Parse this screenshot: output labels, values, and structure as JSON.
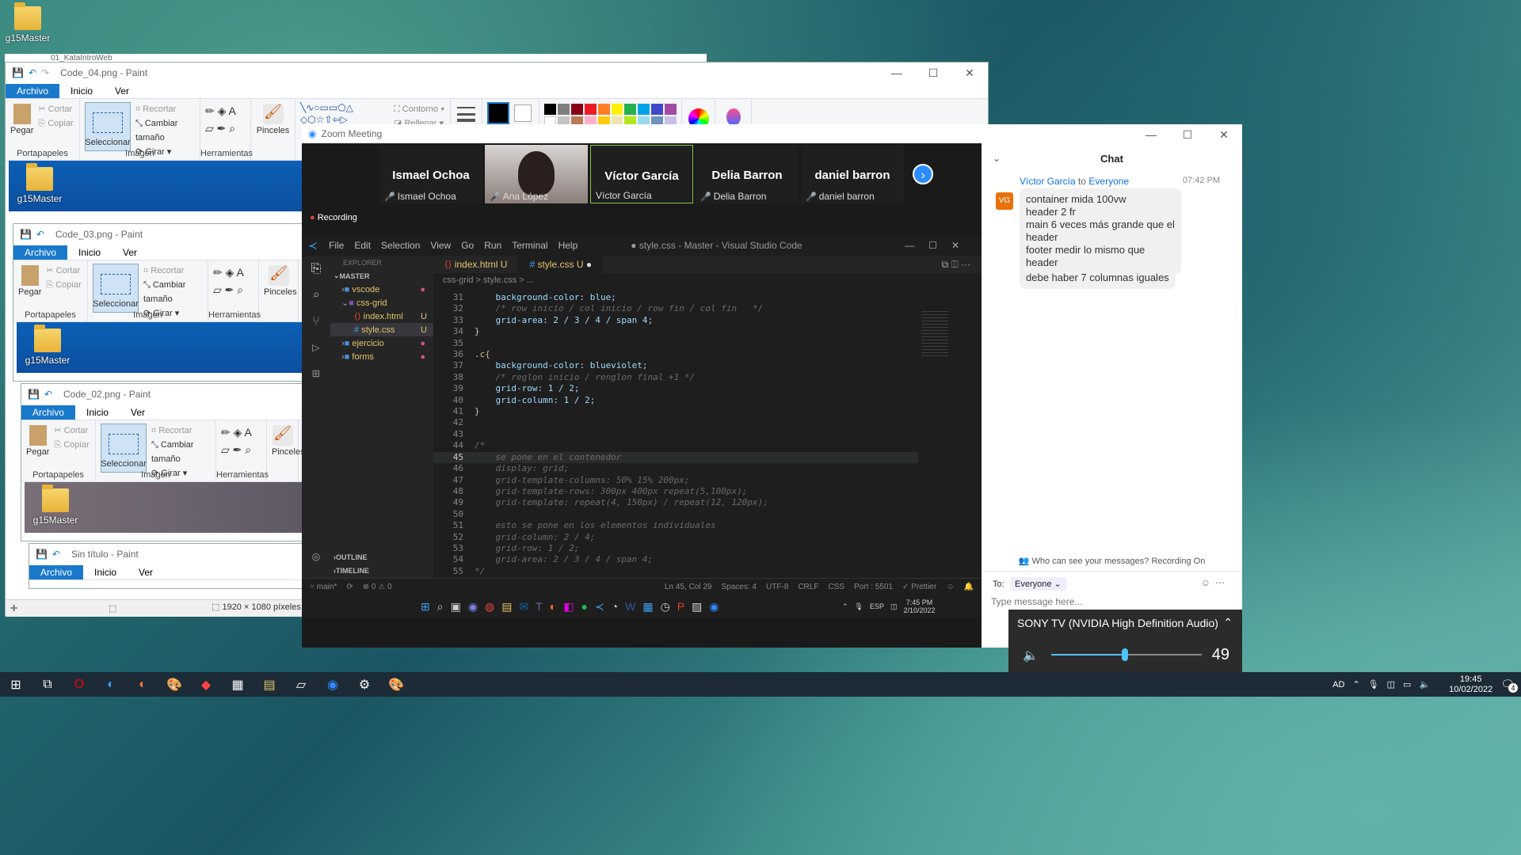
{
  "desktop": {
    "icon_label": "g15Master"
  },
  "bg_paint": {
    "title": "01_KataIntroWeb"
  },
  "paint_windows": [
    {
      "title": "Code_04.png - Paint",
      "folder_label": "g15Master"
    },
    {
      "title": "Code_03.png - Paint",
      "folder_label": "g15Master"
    },
    {
      "title": "Code_02.png - Paint",
      "folder_label": "g15Master"
    },
    {
      "title": "Sin título - Paint"
    }
  ],
  "paint_ribbon": {
    "tab_file": "Archivo",
    "tab_home": "Inicio",
    "tab_view": "Ver",
    "paste": "Pegar",
    "cut": "Cortar",
    "copy": "Copiar",
    "select": "Seleccionar",
    "crop": "Recortar",
    "resize": "Cambiar tamaño",
    "rotate": "Girar",
    "brushes": "Pinceles",
    "outline": "Contorno",
    "fill": "Rellenar",
    "group_clipboard": "Portapapeles",
    "group_image": "Imagen",
    "group_tools": "Herramientas"
  },
  "paint_status": {
    "dimensions": "1920 × 1080 píxeles"
  },
  "zoom": {
    "title": "Zoom Meeting",
    "recording": "Recording",
    "participants": [
      {
        "big": "Ismael Ochoa",
        "label": "Ismael Ochoa"
      },
      {
        "big": "",
        "label": "Ana López"
      },
      {
        "big": "Víctor García",
        "label": "Víctor García"
      },
      {
        "big": "Delia Barron",
        "label": "Delia Barron"
      },
      {
        "big": "daniel barron",
        "label": "daniel barron"
      }
    ]
  },
  "vscode": {
    "menu": [
      "File",
      "Edit",
      "Selection",
      "View",
      "Go",
      "Run",
      "Terminal",
      "Help"
    ],
    "title": "● style.css - Master - Visual Studio Code",
    "explorer": "EXPLORER",
    "master": "MASTER",
    "tree": [
      {
        "name": "vscode",
        "type": "folder",
        "indent": 0
      },
      {
        "name": "css-grid",
        "type": "folder-open",
        "indent": 0
      },
      {
        "name": "index.html",
        "type": "html",
        "indent": 1,
        "badge": "U"
      },
      {
        "name": "style.css",
        "type": "css",
        "indent": 1,
        "badge": "U"
      },
      {
        "name": "ejercicio",
        "type": "folder",
        "indent": 0
      },
      {
        "name": "forms",
        "type": "folder",
        "indent": 0
      }
    ],
    "outline": "OUTLINE",
    "timeline": "TIMELINE",
    "tabs": [
      {
        "label": "index.html",
        "badge": "U"
      },
      {
        "label": "style.css",
        "badge": "U"
      }
    ],
    "breadcrumb": "css-grid  >  style.css  >  ...",
    "code": [
      {
        "n": "31",
        "t": "    background-color: blue;",
        "k": "prop"
      },
      {
        "n": "32",
        "t": "    /* row inicio / col inicio / row fin / col fin   */",
        "k": "cm"
      },
      {
        "n": "33",
        "t": "    grid-area: 2 / 3 / 4 / span 4;",
        "k": "prop"
      },
      {
        "n": "34",
        "t": "}",
        "k": "br"
      },
      {
        "n": "35",
        "t": "",
        "k": ""
      },
      {
        "n": "36",
        "t": ".c{",
        "k": "sel"
      },
      {
        "n": "37",
        "t": "    background-color: blueviolet;",
        "k": "prop"
      },
      {
        "n": "38",
        "t": "    /* reglon inicio / renglon final +1 */",
        "k": "cm"
      },
      {
        "n": "39",
        "t": "    grid-row: 1 / 2;",
        "k": "prop"
      },
      {
        "n": "40",
        "t": "    grid-column: 1 / 2;",
        "k": "prop"
      },
      {
        "n": "41",
        "t": "}",
        "k": "br"
      },
      {
        "n": "42",
        "t": "",
        "k": ""
      },
      {
        "n": "43",
        "t": "",
        "k": ""
      },
      {
        "n": "44",
        "t": "/*",
        "k": "cm"
      },
      {
        "n": "45",
        "t": "    se pone en el contenedor",
        "k": "cm"
      },
      {
        "n": "46",
        "t": "    display: grid;",
        "k": "cm"
      },
      {
        "n": "47",
        "t": "    grid-template-columns: 50% 15% 200px;",
        "k": "cm"
      },
      {
        "n": "48",
        "t": "    grid-template-rows: 300px 400px repeat(5,100px);",
        "k": "cm"
      },
      {
        "n": "49",
        "t": "    grid-template: repeat(4, 150px) / repeat(12, 120px);",
        "k": "cm"
      },
      {
        "n": "50",
        "t": "",
        "k": ""
      },
      {
        "n": "51",
        "t": "    esto se pone en los elementos individuales",
        "k": "cm"
      },
      {
        "n": "52",
        "t": "    grid-column: 2 / 4;",
        "k": "cm"
      },
      {
        "n": "53",
        "t": "    grid-row: 1 / 2;",
        "k": "cm"
      },
      {
        "n": "54",
        "t": "    grid-area: 2 / 3 / 4 / span 4;",
        "k": "cm"
      },
      {
        "n": "55",
        "t": "*/",
        "k": "cm"
      }
    ],
    "status": {
      "branch": "main*",
      "errors": "⊗ 0 ⚠ 0",
      "pos": "Ln 45, Col 29",
      "spaces": "Spaces: 4",
      "enc": "UTF-8",
      "eol": "CRLF",
      "lang": "CSS",
      "port": "Port : 5501",
      "prettier": "✓ Prettier"
    }
  },
  "chat": {
    "title": "Chat",
    "sender": "Víctor García",
    "to": "to",
    "recipient": "Everyone",
    "time": "07:42 PM",
    "avatar": "VG",
    "messages": [
      "container mida 100vw",
      "header  2 fr",
      "main 6 veces más grande que el header",
      "footer medir lo mismo que header"
    ],
    "message2": "debe haber 7 columnas iguales",
    "privacy": "Who can see your messages? Recording On",
    "to_label": "To:",
    "to_value": "Everyone",
    "placeholder": "Type message here..."
  },
  "inner_taskbar": {
    "lang": "ESP",
    "time": "7:45 PM",
    "date": "2/10/2022"
  },
  "volume": {
    "device": "SONY TV (NVIDIA High Definition Audio)",
    "level": 49
  },
  "taskbar": {
    "lang": "AD",
    "time": "19:45",
    "date": "10/02/2022",
    "notif": "4"
  }
}
